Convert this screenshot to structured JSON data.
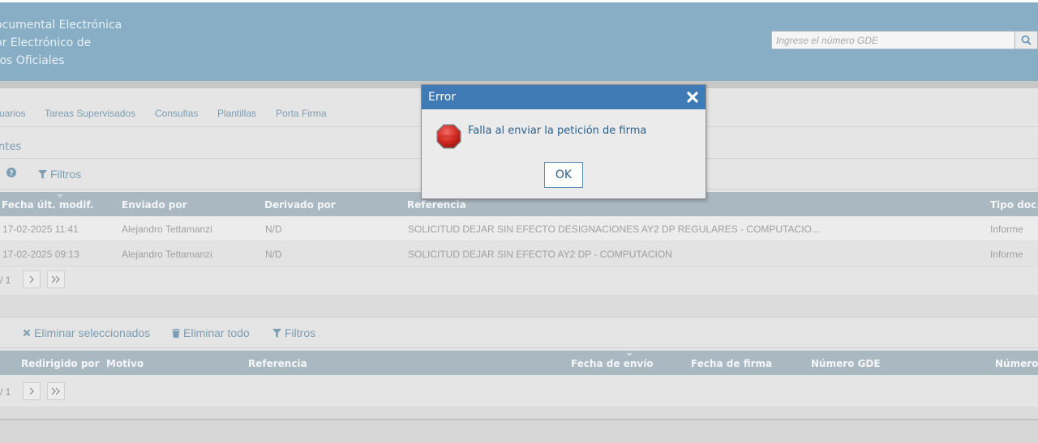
{
  "header": {
    "title_lines": [
      "ocumental Electrónica",
      "or Electrónico de",
      "tos Oficiales"
    ],
    "search_placeholder": "Ingrese el número GDE"
  },
  "nav": {
    "items": [
      "uarios",
      "Tareas Supervisados",
      "Consultas",
      "Plantillas",
      "Porta Firma"
    ]
  },
  "section1": {
    "title": "ntes",
    "toolbar": {
      "help_icon": "question-circle-icon",
      "filters_label": "Filtros"
    },
    "columns": [
      "Fecha últ. modif.",
      "Enviado por",
      "Derivado por",
      "Referencia",
      "Tipo doc."
    ],
    "rows": [
      {
        "fecha": "17-02-2025 11:41",
        "enviado": "Alejandro Tettamanzi",
        "derivado": "N/D",
        "referencia": "SOLICITUD DEJAR SIN EFECTO DESIGNACIONES AY2 DP REGULARES - COMPUTACIO...",
        "tipo": "Informe"
      },
      {
        "fecha": "17-02-2025 09:13",
        "enviado": "Alejandro Tettamanzi",
        "derivado": "N/D",
        "referencia": "SOLICITUD DEJAR SIN EFECTO AY2 DP - COMPUTACION",
        "tipo": "Informe"
      }
    ],
    "pager_text": "/ 1"
  },
  "section2": {
    "toolbar": {
      "delete_selected_label": "Eliminar seleccionados",
      "delete_all_label": "Eliminar todo",
      "filters_label": "Filtros"
    },
    "columns": [
      "Redirigido por",
      "Motivo",
      "Referencia",
      "Fecha de envío",
      "Fecha de firma",
      "Número GDE",
      "Número e"
    ],
    "pager_text": "/ 1"
  },
  "dialog": {
    "title": "Error",
    "message": "Falla al enviar la petición de firma",
    "ok_label": "OK"
  },
  "colors": {
    "header_bg": "#87aec5",
    "dialog_header": "#3f7ab5",
    "link": "#7d9db2",
    "table_header": "#aab8c2"
  }
}
